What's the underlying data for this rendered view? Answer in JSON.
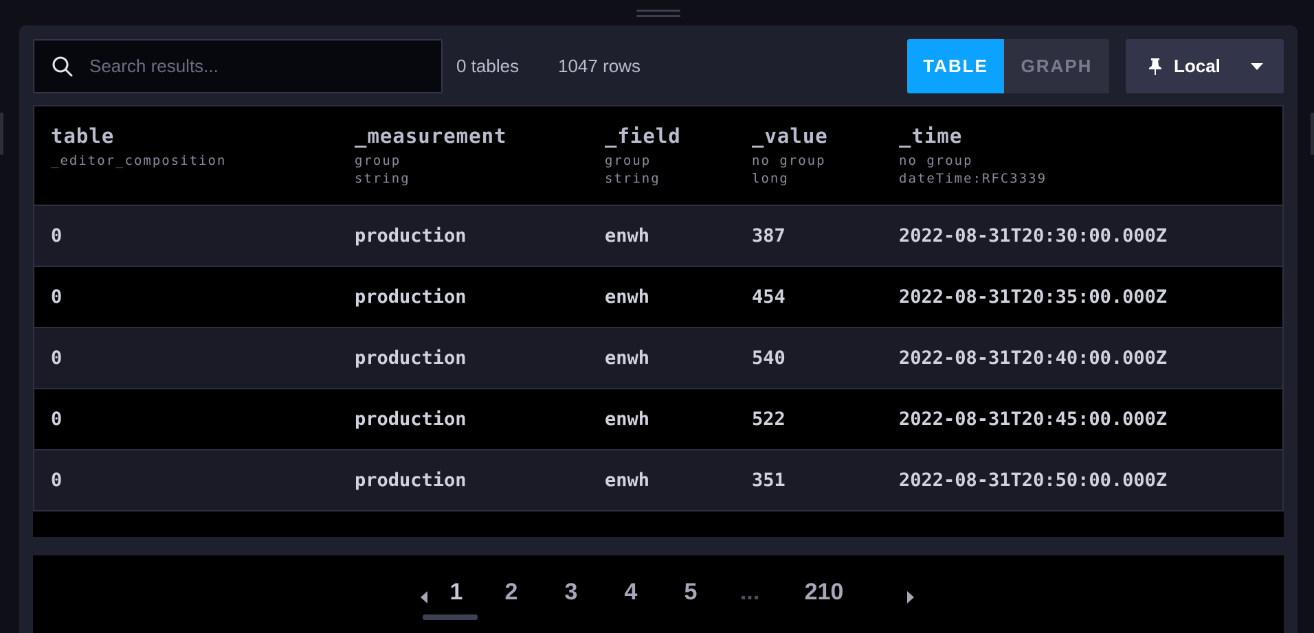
{
  "search": {
    "placeholder": "Search results..."
  },
  "stats": {
    "tables": "0 tables",
    "rows": "1047 rows"
  },
  "view_toggle": {
    "table_label": "TABLE",
    "graph_label": "GRAPH",
    "active": "TABLE"
  },
  "timezone": {
    "label": "Local"
  },
  "table": {
    "columns": [
      {
        "name": "table",
        "meta1": "_editor_composition",
        "meta2": ""
      },
      {
        "name": "_measurement",
        "meta1": "group",
        "meta2": "string"
      },
      {
        "name": "_field",
        "meta1": "group",
        "meta2": "string"
      },
      {
        "name": "_value",
        "meta1": "no group",
        "meta2": "long"
      },
      {
        "name": "_time",
        "meta1": "no group",
        "meta2": "dateTime:RFC3339"
      }
    ],
    "rows": [
      [
        "0",
        "production",
        "enwh",
        "387",
        "2022-08-31T20:30:00.000Z"
      ],
      [
        "0",
        "production",
        "enwh",
        "454",
        "2022-08-31T20:35:00.000Z"
      ],
      [
        "0",
        "production",
        "enwh",
        "540",
        "2022-08-31T20:40:00.000Z"
      ],
      [
        "0",
        "production",
        "enwh",
        "522",
        "2022-08-31T20:45:00.000Z"
      ],
      [
        "0",
        "production",
        "enwh",
        "351",
        "2022-08-31T20:50:00.000Z"
      ]
    ]
  },
  "pagination": {
    "pages": [
      "1",
      "2",
      "3",
      "4",
      "5"
    ],
    "ellipsis": "...",
    "last": "210",
    "current": "1"
  },
  "colors": {
    "accent": "#0ba3ff",
    "panel": "#1f202d",
    "table_bg": "#000000"
  }
}
